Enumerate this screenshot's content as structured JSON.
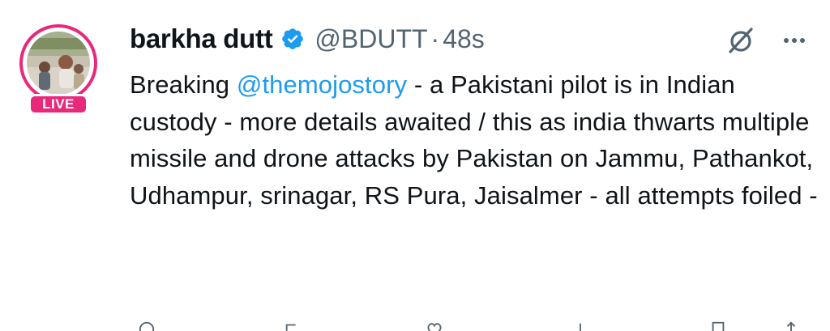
{
  "author": {
    "display_name": "barkha dutt",
    "handle": "@BDUTT",
    "separator": "·",
    "time": "48s",
    "live_label": "LIVE"
  },
  "tweet": {
    "prefix": "Breaking ",
    "mention": "@themojostory",
    "text": " - a Pakistani pilot is in Indian custody - more details awaited / this as india thwarts multiple missile and drone attacks by Pakistan on Jammu, Pathankot, Udhampur, srinagar, RS Pura, Jaisalmer - all attempts foiled -"
  },
  "icons": {
    "verified": "verified-badge-icon",
    "grok": "grok-icon",
    "more": "more-options-icon"
  },
  "colors": {
    "live_pink": "#e8287a",
    "link_blue": "#1d9bf0",
    "verified_blue": "#1d9bf0",
    "secondary_text": "#536471",
    "primary_text": "#0f1419"
  }
}
